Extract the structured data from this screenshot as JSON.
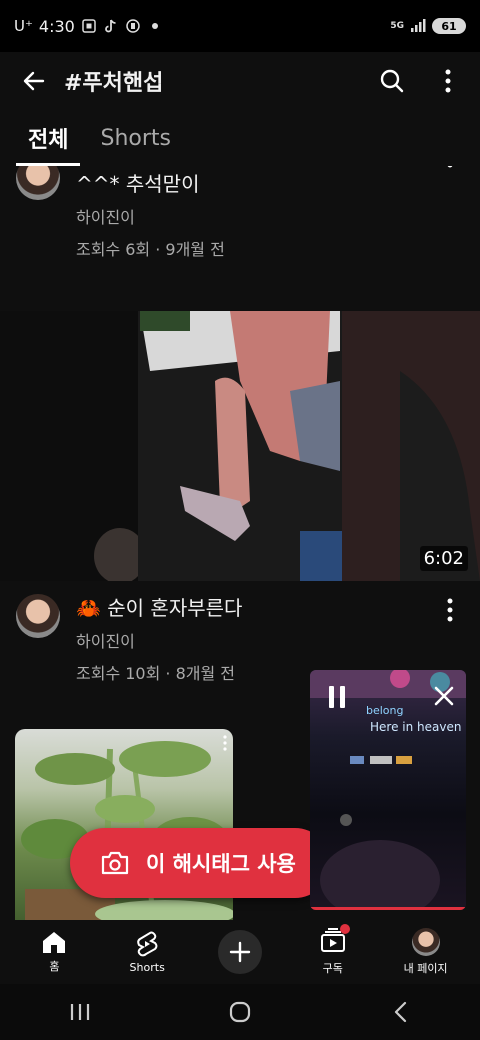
{
  "status_bar": {
    "carrier": "U⁺",
    "time": "4:30",
    "network": "5G",
    "battery": "61"
  },
  "app_bar": {
    "title": "#푸처핸섭"
  },
  "tabs": [
    {
      "label": "전체",
      "active": true
    },
    {
      "label": "Shorts",
      "active": false
    }
  ],
  "videos": [
    {
      "title_partial": "^^* 추석맏이",
      "channel": "하이진이",
      "stats": "조회수 6회 · 9개월 전"
    },
    {
      "duration": "6:02",
      "title": "🦀 순이 혼자부른다",
      "channel": "하이진이",
      "stats": "조회수 10회 · 8개월 전"
    }
  ],
  "fab": {
    "label": "이 해시태그 사용"
  },
  "mini_player": {
    "lyric_line1": "belong",
    "lyric_line2": "Here in heaven",
    "progress": 1.0
  },
  "bottom_nav": [
    {
      "label": "홈",
      "icon": "home-icon"
    },
    {
      "label": "Shorts",
      "icon": "shorts-icon"
    },
    {
      "label": "",
      "icon": "plus-icon"
    },
    {
      "label": "구독",
      "icon": "subscriptions-icon"
    },
    {
      "label": "내 페이지",
      "icon": "avatar"
    }
  ],
  "colors": {
    "background": "#0f0f0f",
    "accent": "#e0313f",
    "secondary_text": "#aaaaaa"
  }
}
